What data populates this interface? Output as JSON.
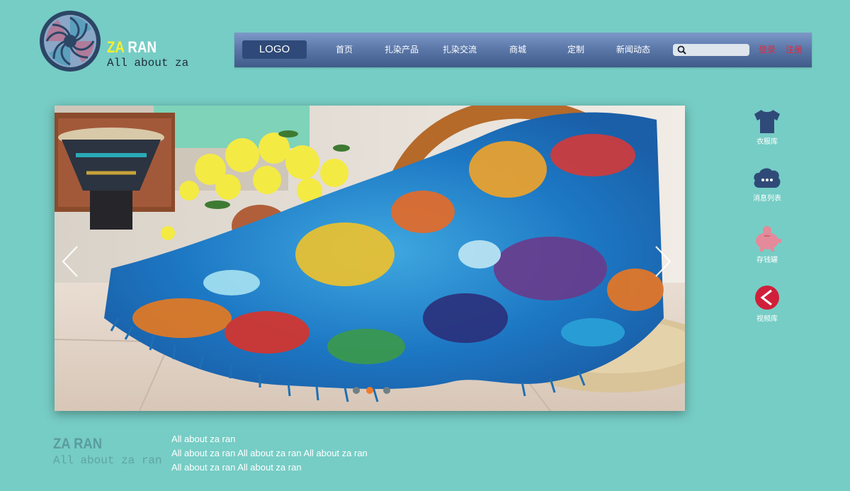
{
  "brand": {
    "title_part1": "ZA",
    "title_part2": " RAN",
    "subtitle": "All about za",
    "logo_icon": "aperture-icon"
  },
  "nav": {
    "logo_label": "LOGO",
    "items": [
      "首页",
      "扎染产品",
      "扎染交流",
      "商城",
      "定制",
      "新闻动态"
    ],
    "search_placeholder": "",
    "login": "登录",
    "register": "注册"
  },
  "carousel": {
    "prev_icon": "chevron-left-icon",
    "next_icon": "chevron-right-icon",
    "slide_count": 3,
    "active_slide": 2
  },
  "side_links": [
    {
      "label": "衣服库",
      "icon": "tshirt-icon"
    },
    {
      "label": "消息列表",
      "icon": "chat-cloud-icon"
    },
    {
      "label": "存钱罐",
      "icon": "piggy-bank-icon"
    },
    {
      "label": "视频库",
      "icon": "play-back-icon"
    }
  ],
  "footer": {
    "title": "ZA RAN",
    "subtitle": "All about za ran",
    "lines": [
      "All about za ran",
      "All about za ran All about za ran All about za ran",
      "All about za ran All about za ran"
    ]
  },
  "colors": {
    "background": "#76cdc5",
    "nav_gradient_top": "#7d98c9",
    "nav_gradient_bottom": "#3f5b89",
    "brand_yellow": "#f3f032",
    "auth_red": "#e8283a",
    "dot_active": "#f07a2a",
    "side_icon_dark": "#2f4a78",
    "side_icon_pink": "#e48a9a",
    "side_icon_red": "#d01f3a"
  }
}
